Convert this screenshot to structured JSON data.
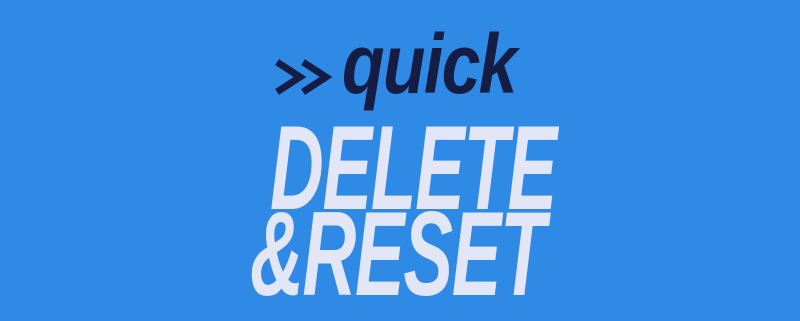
{
  "colors": {
    "background": "#2f8ae6",
    "dark_text": "#151d45",
    "light_text": "#e3e6f7"
  },
  "icons": {
    "arrows": "double-chevron-right-icon"
  },
  "logo": {
    "line1": "quick",
    "line2": "DELETE",
    "line3": "&RESET"
  }
}
